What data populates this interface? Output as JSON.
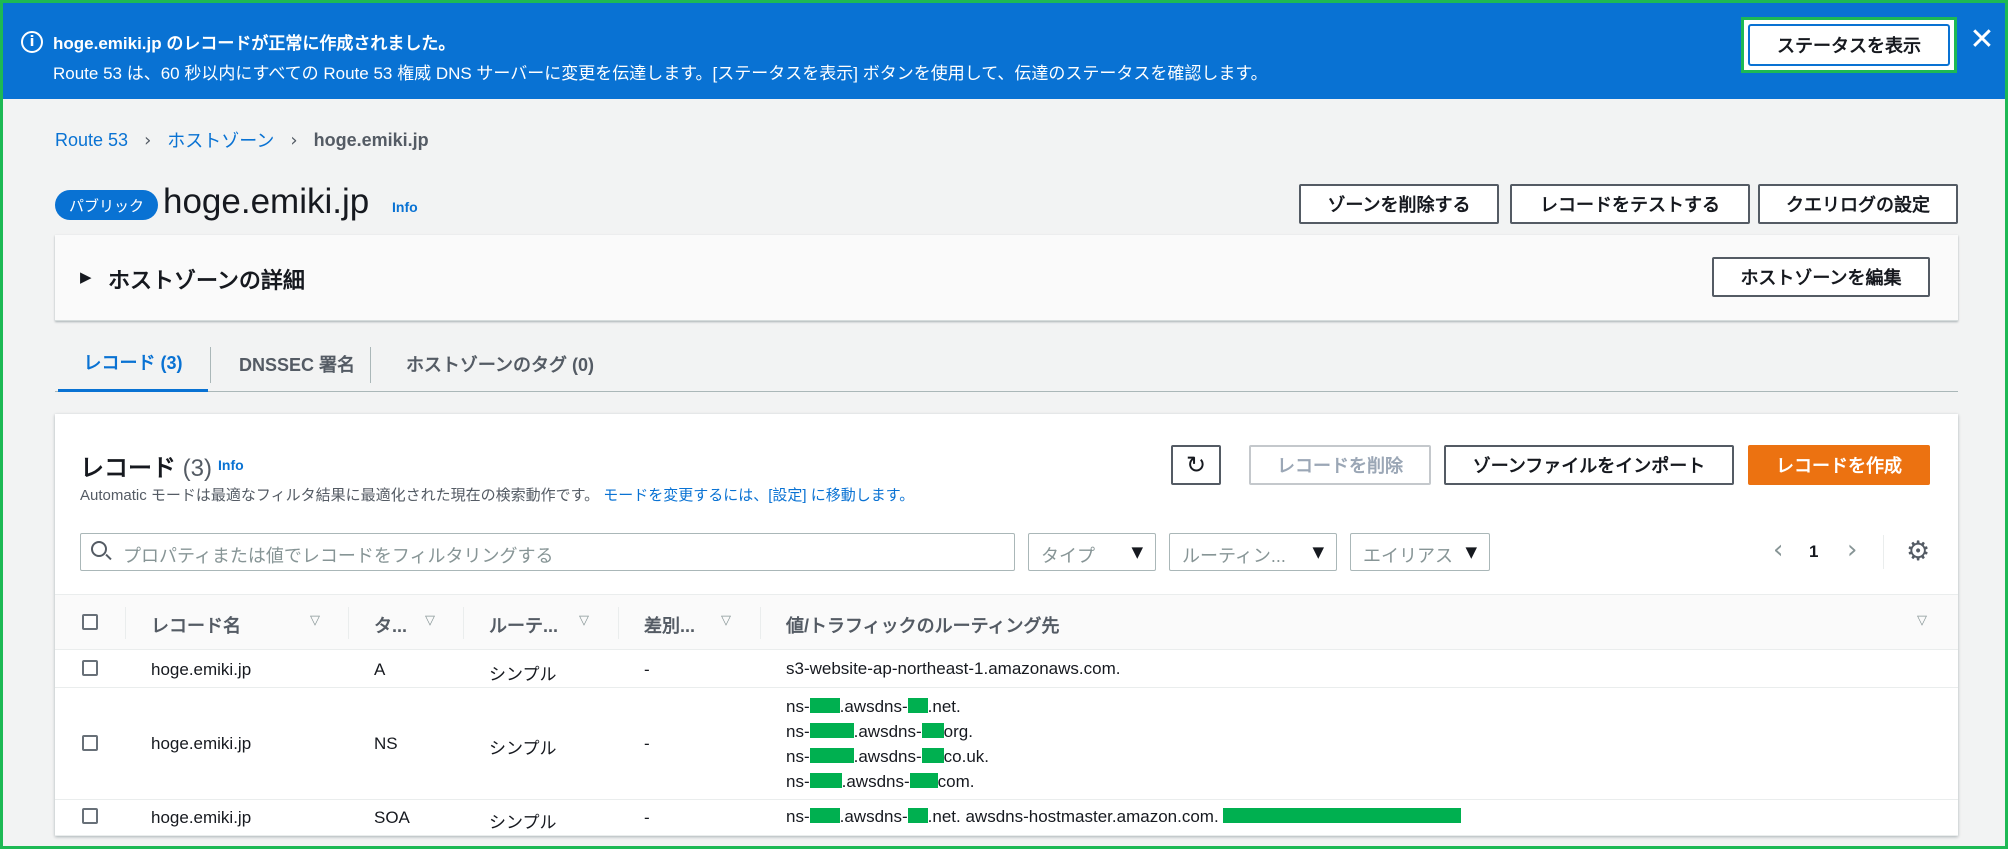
{
  "flash": {
    "title": "hoge.emiki.jp のレコードが正常に作成されました。",
    "text": "Route 53 は、60 秒以内にすべての Route 53 権威 DNS サーバーに変更を伝達します。[ステータスを表示] ボタンを使用して、伝達のステータスを確認します。",
    "button": "ステータスを表示",
    "close": "✕",
    "info_icon": "i"
  },
  "breadcrumb": {
    "items": [
      "Route 53",
      "ホストゾーン"
    ],
    "current": "hoge.emiki.jp",
    "separator": "›"
  },
  "header": {
    "badge": "パブリック",
    "title": "hoge.emiki.jp",
    "info": "Info",
    "buttons": {
      "delete_zone": "ゾーンを削除する",
      "test_record": "レコードをテストする",
      "query_log": "クエリログの設定"
    }
  },
  "details": {
    "title": "ホストゾーンの詳細",
    "caret": "▶",
    "edit_button": "ホストゾーンを編集"
  },
  "tabs": [
    {
      "label": "レコード (3)"
    },
    {
      "label": "DNSSEC 署名"
    },
    {
      "label": "ホストゾーンのタグ (0)"
    }
  ],
  "records": {
    "title": "レコード",
    "count": "(3)",
    "info": "Info",
    "description": "Automatic モードは最適なフィルタ結果に最適化された現在の検索動作です。",
    "description_link": "モードを変更するには、[設定] に移動します。",
    "buttons": {
      "refresh": "↻",
      "delete": "レコードを削除",
      "import": "ゾーンファイルをインポート",
      "create": "レコードを作成"
    },
    "search_placeholder": "プロパティまたは値でレコードをフィルタリングする",
    "filters": {
      "type": "タイプ",
      "routing": "ルーティン...",
      "alias": "エイリアス"
    },
    "caret": "▼",
    "pager": {
      "prev": "‹",
      "page": "1",
      "next": "›"
    },
    "settings_icon": "⚙",
    "columns": {
      "name": "レコード名",
      "type": "タ...",
      "routing": "ルーテ...",
      "differentiator": "差別...",
      "value": "値/トラフィックのルーティング先"
    },
    "sort_caret": "▽",
    "rows": [
      {
        "name": "hoge.emiki.jp",
        "type": "A",
        "routing": "シンプル",
        "differentiator": "-",
        "value_lines": [
          [
            {
              "t": "s3-website-ap-northeast-1.amazonaws.com."
            }
          ]
        ]
      },
      {
        "name": "hoge.emiki.jp",
        "type": "NS",
        "routing": "シンプル",
        "differentiator": "-",
        "value_lines": [
          [
            {
              "t": "ns-"
            },
            {
              "r": 30
            },
            {
              "t": ".awsdns-"
            },
            {
              "r": 20
            },
            {
              "t": ".net."
            }
          ],
          [
            {
              "t": "ns-"
            },
            {
              "r": 44
            },
            {
              "t": ".awsdns-"
            },
            {
              "r": 22
            },
            {
              "t": "org."
            }
          ],
          [
            {
              "t": "ns-"
            },
            {
              "r": 44
            },
            {
              "t": ".awsdns-"
            },
            {
              "r": 22
            },
            {
              "t": "co.uk."
            }
          ],
          [
            {
              "t": "ns-"
            },
            {
              "r": 32
            },
            {
              "t": ".awsdns-"
            },
            {
              "r": 28
            },
            {
              "t": "com."
            }
          ]
        ]
      },
      {
        "name": "hoge.emiki.jp",
        "type": "SOA",
        "routing": "シンプル",
        "differentiator": "-",
        "value_lines": [
          [
            {
              "t": "ns-"
            },
            {
              "r": 30
            },
            {
              "t": ".awsdns-"
            },
            {
              "r": 20
            },
            {
              "t": ".net. awsdns-hostmaster.amazon.com. "
            },
            {
              "r": 238
            }
          ]
        ]
      }
    ]
  },
  "colors": {
    "flash_bg": "#0972d3",
    "link": "#0972d3",
    "primary_button": "#ec7211",
    "redaction": "#00b050",
    "frame": "#1db954"
  }
}
